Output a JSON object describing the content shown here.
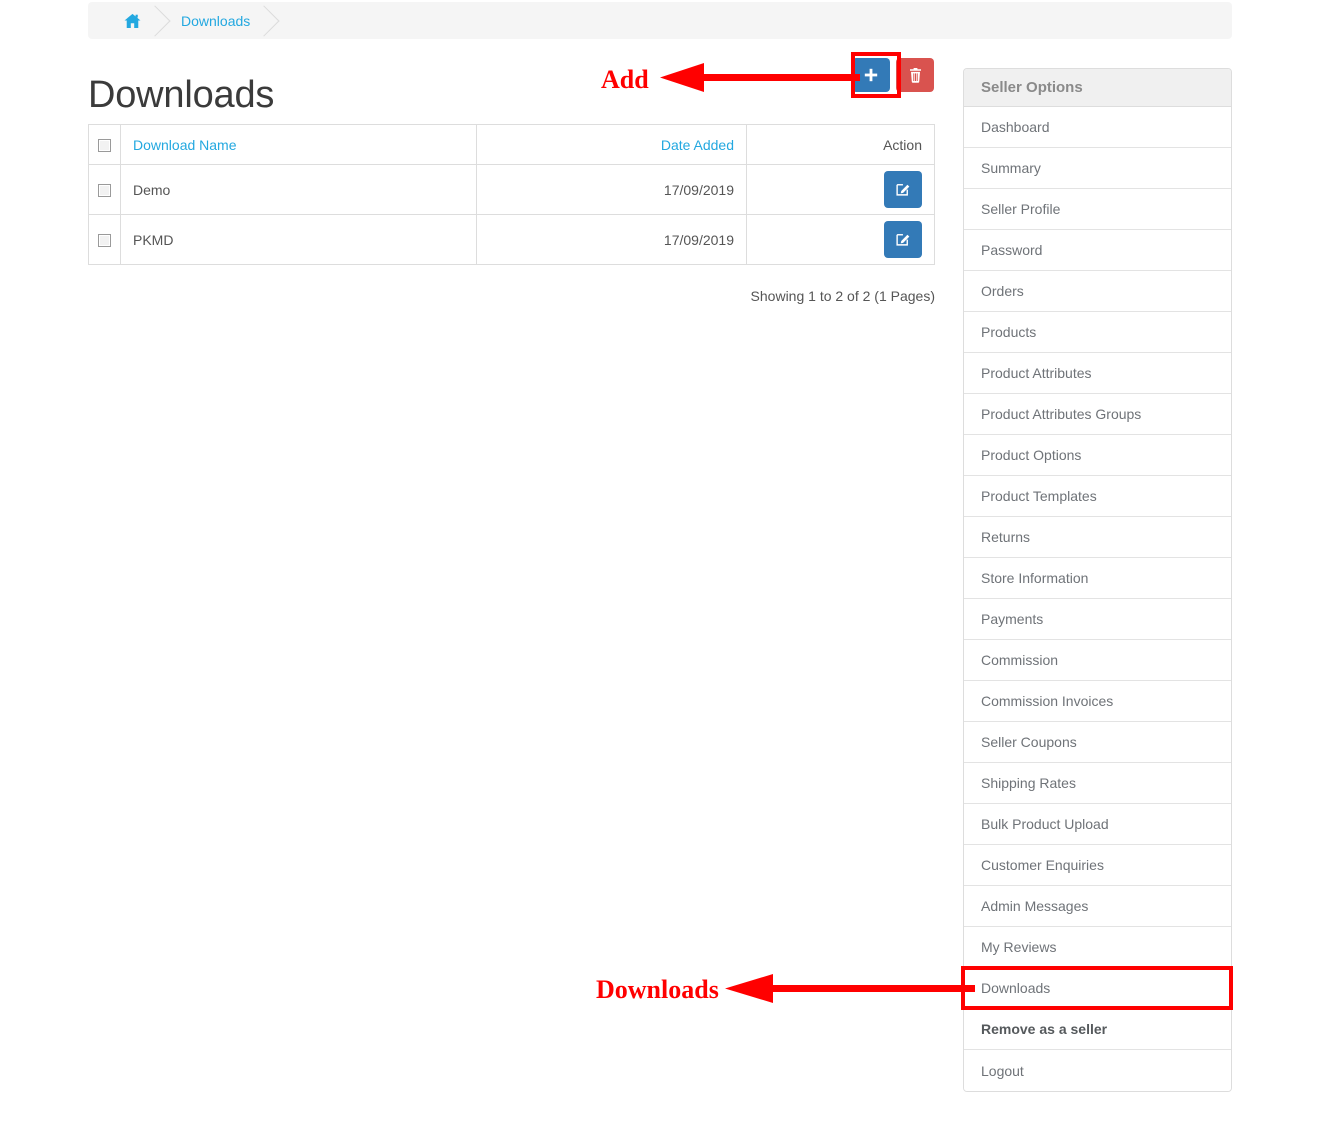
{
  "breadcrumb": {
    "home_icon": "home-icon",
    "items": [
      {
        "label": "",
        "icon": "home-icon"
      },
      {
        "label": "Downloads"
      }
    ]
  },
  "page": {
    "title": "Downloads"
  },
  "toolbar": {
    "add_label": "+",
    "add_icon": "plus-icon",
    "delete_icon": "trash-icon",
    "add_color": "#337ab7",
    "delete_color": "#d9534f"
  },
  "table": {
    "columns": [
      {
        "label": "",
        "name": "select-all"
      },
      {
        "label": "Download Name",
        "name": "download-name",
        "link": true
      },
      {
        "label": "Date Added",
        "name": "date-added",
        "link": true
      },
      {
        "label": "Action",
        "name": "action",
        "link": false
      }
    ],
    "rows": [
      {
        "name": "Demo",
        "date": "17/09/2019",
        "edit_icon": "edit-icon"
      },
      {
        "name": "PKMD",
        "date": "17/09/2019",
        "edit_icon": "edit-icon"
      }
    ],
    "footer": "Showing 1 to 2 of 2 (1 Pages)"
  },
  "sidebar": {
    "header": "Seller Options",
    "items": [
      {
        "label": "Dashboard"
      },
      {
        "label": "Summary"
      },
      {
        "label": "Seller Profile"
      },
      {
        "label": "Password"
      },
      {
        "label": "Orders"
      },
      {
        "label": "Products"
      },
      {
        "label": "Product Attributes"
      },
      {
        "label": "Product Attributes Groups"
      },
      {
        "label": "Product Options"
      },
      {
        "label": "Product Templates"
      },
      {
        "label": "Returns"
      },
      {
        "label": "Store Information"
      },
      {
        "label": "Payments"
      },
      {
        "label": "Commission"
      },
      {
        "label": "Commission Invoices"
      },
      {
        "label": "Seller Coupons"
      },
      {
        "label": "Shipping Rates"
      },
      {
        "label": "Bulk Product Upload"
      },
      {
        "label": "Customer Enquiries"
      },
      {
        "label": "Admin Messages"
      },
      {
        "label": "My Reviews"
      },
      {
        "label": "Downloads"
      },
      {
        "label": "Remove as a seller",
        "bold": true
      },
      {
        "label": "Logout"
      }
    ]
  },
  "annotations": {
    "color": "#ff0000",
    "add_label": "Add",
    "downloads_label": "Downloads"
  }
}
